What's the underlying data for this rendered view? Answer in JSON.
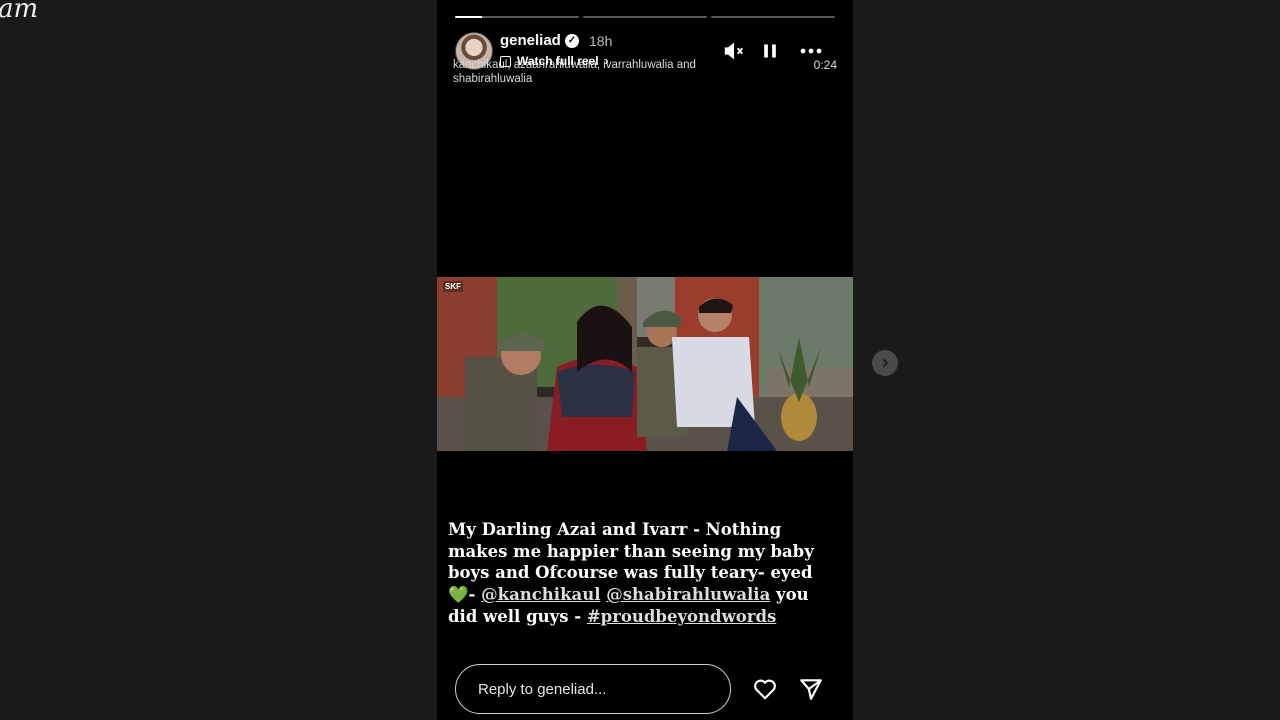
{
  "brand": {
    "text": "am"
  },
  "story": {
    "progress": [
      0.22,
      0,
      0
    ],
    "username": "geneliad",
    "verified_icon": "verified-badge-icon",
    "time": "18h",
    "reel_link": "Watch full reel",
    "credits": "kanchikaul, azaanrahluwalia, ivarrahluwalia and shabirahluwalia",
    "duration": "0:24",
    "watermark": "SKF",
    "caption": {
      "line1": "My Darling Azai and Ivarr - Nothing makes me happier than seeing my baby boys and Ofcourse was fully teary- eyed 💚- ",
      "mention1": "@kanchikaul",
      "mention2": "@shabirahluwalia",
      "mid": " you did well guys - ",
      "hashtag": "#proudbeyondwords"
    },
    "reply_placeholder": "Reply to geneliad...",
    "icons": {
      "mute": "muted-speaker-icon",
      "pause": "pause-icon",
      "more": "more-options-icon",
      "like": "heart-icon",
      "share": "send-icon",
      "next": "chevron-right-icon"
    }
  }
}
